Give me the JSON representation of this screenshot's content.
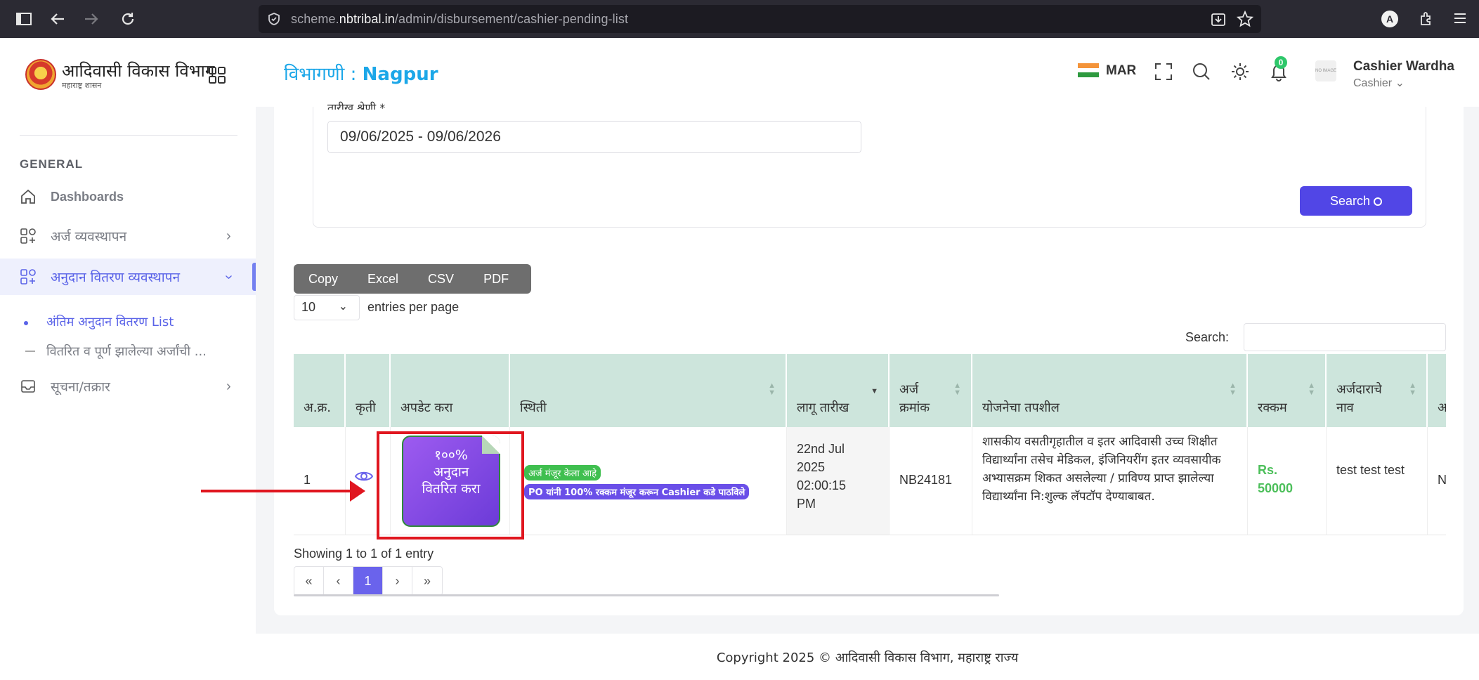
{
  "browser": {
    "url_prefix": "scheme.",
    "url_domain": "nbtribal.in",
    "url_path": "/admin/disbursement/cashier-pending-list"
  },
  "sidebar": {
    "logo_title": "आदिवासी विकास विभाग",
    "logo_subtitle": "महाराष्ट्र शासन",
    "section_heading": "GENERAL",
    "items": [
      {
        "label": "Dashboards",
        "icon": "home-icon"
      },
      {
        "label": "अर्ज व्यवस्थापन",
        "icon": "apps-icon"
      },
      {
        "label": "अनुदान वितरण व्यवस्थापन",
        "icon": "apps-icon"
      },
      {
        "label": "सूचना/तक्रार",
        "icon": "inbox-icon"
      }
    ],
    "sub_items": [
      {
        "label": "अंतिम अनुदान वितरण List"
      },
      {
        "label": "वितरित व पूर्ण झालेल्या अर्जांची ..."
      }
    ]
  },
  "header": {
    "dept_label": "विभागणी : ",
    "dept_name": "Nagpur",
    "language": "MAR",
    "notification_count": "0",
    "avatar_text": "NO IMAGE",
    "user_name": "Cashier Wardha",
    "user_role": "Cashier"
  },
  "filter": {
    "date_label": "तारीख श्रेणी *",
    "date_range": "09/06/2025 - 09/06/2026",
    "search_button": "Search"
  },
  "table_controls": {
    "export_buttons": [
      "Copy",
      "Excel",
      "CSV",
      "PDF"
    ],
    "entries_value": "10",
    "entries_label": "entries per page",
    "search_label": "Search:"
  },
  "table": {
    "headers": [
      "अ.क्र.",
      "कृती",
      "अपडेट करा",
      "स्थिती",
      "लागू तारीख",
      "अर्ज क्रमांक",
      "योजनेचा तपशील",
      "रक्कम",
      "अर्जदाराचे नाव",
      "अ"
    ],
    "rows": [
      {
        "serial": "1",
        "update_label": "१००% अनुदान वितरित करा",
        "status_1": "अर्ज मंजूर केला आहे",
        "status_2": "PO यांनी 100% रक्कम मंजूर करून Cashier कडे पाठविले",
        "date": "22nd Jul 2025 02:00:15 PM",
        "app_no": "NB24181",
        "scheme": "शासकीय वसतीगृहातील व इतर आदिवासी उच्च शिक्षीत विद्यार्थ्यांना तसेच मेडिकल, इंजिनियरींग इतर व्यवसायीक अभ्यासक्रम शिकत असलेल्या / प्राविण्य प्राप्त झालेल्या विद्यार्थ्यांना नि:शुल्क लॅपटॉप देण्याबाबत.",
        "amount": "Rs. 50000",
        "name": "test test test",
        "extra": "N"
      }
    ]
  },
  "pagination": {
    "showing": "Showing 1 to 1 of 1 entry",
    "first": "«",
    "prev": "‹",
    "current": "1",
    "next": "›",
    "last": "»"
  },
  "footer": {
    "copyright": "Copyright 2025 © आदिवासी विकास विभाग, महाराष्ट्र राज्य"
  },
  "colors": {
    "accent": "#5a63e8",
    "primary_button": "#5146e6",
    "table_header": "#cde5dc",
    "annotation": "#e0161f"
  }
}
